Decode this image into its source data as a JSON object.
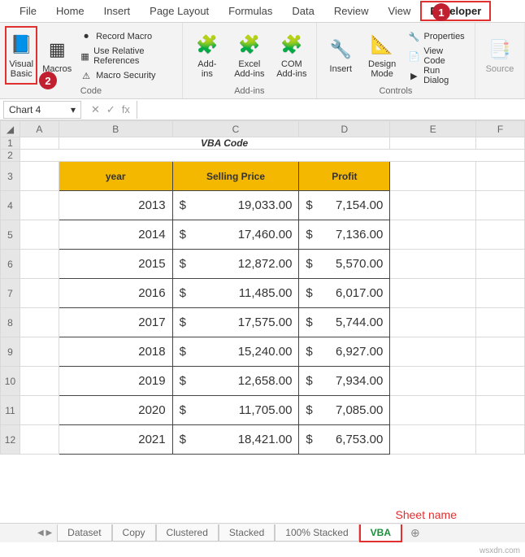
{
  "tabs": {
    "file": "File",
    "home": "Home",
    "insert": "Insert",
    "pagelayout": "Page Layout",
    "formulas": "Formulas",
    "data": "Data",
    "review": "Review",
    "view": "View",
    "developer": "Developer"
  },
  "badges": {
    "one": "1",
    "two": "2"
  },
  "ribbon": {
    "code": {
      "label": "Code",
      "visualbasic": "Visual\nBasic",
      "macros": "Macros",
      "record": "Record Macro",
      "relative": "Use Relative References",
      "security": "Macro Security"
    },
    "addins": {
      "label": "Add-ins",
      "addins": "Add-\nins",
      "excel": "Excel\nAdd-ins",
      "com": "COM\nAdd-ins"
    },
    "controls": {
      "label": "Controls",
      "insert": "Insert",
      "design": "Design\nMode",
      "properties": "Properties",
      "viewcode": "View Code",
      "rundialog": "Run Dialog"
    },
    "xml": {
      "source": "Source"
    }
  },
  "namebox": "Chart 4",
  "fx": "fx",
  "title": "VBA Code",
  "headers": {
    "year": "year",
    "selling": "Selling Price",
    "profit": "Profit"
  },
  "cols": {
    "A": "A",
    "B": "B",
    "C": "C",
    "D": "D",
    "E": "E",
    "F": "F"
  },
  "rownums": [
    "1",
    "2",
    "3",
    "4",
    "5",
    "6",
    "7",
    "8",
    "9",
    "10",
    "11",
    "12"
  ],
  "currency": "$",
  "rows": [
    {
      "year": "2013",
      "selling": "19,033.00",
      "profit": "7,154.00"
    },
    {
      "year": "2014",
      "selling": "17,460.00",
      "profit": "7,136.00"
    },
    {
      "year": "2015",
      "selling": "12,872.00",
      "profit": "5,570.00"
    },
    {
      "year": "2016",
      "selling": "11,485.00",
      "profit": "6,017.00"
    },
    {
      "year": "2017",
      "selling": "17,575.00",
      "profit": "5,744.00"
    },
    {
      "year": "2018",
      "selling": "15,240.00",
      "profit": "6,927.00"
    },
    {
      "year": "2019",
      "selling": "12,658.00",
      "profit": "7,934.00"
    },
    {
      "year": "2020",
      "selling": "11,705.00",
      "profit": "7,085.00"
    },
    {
      "year": "2021",
      "selling": "18,421.00",
      "profit": "6,753.00"
    }
  ],
  "sheets": {
    "nav": "◀ ▶",
    "dataset": "Dataset",
    "copy": "Copy",
    "clustered": "Clustered",
    "stacked": "Stacked",
    "stacked100": "100% Stacked",
    "vba": "VBA",
    "add": "⊕",
    "label": "Sheet name"
  },
  "watermark": "wsxdn.com"
}
